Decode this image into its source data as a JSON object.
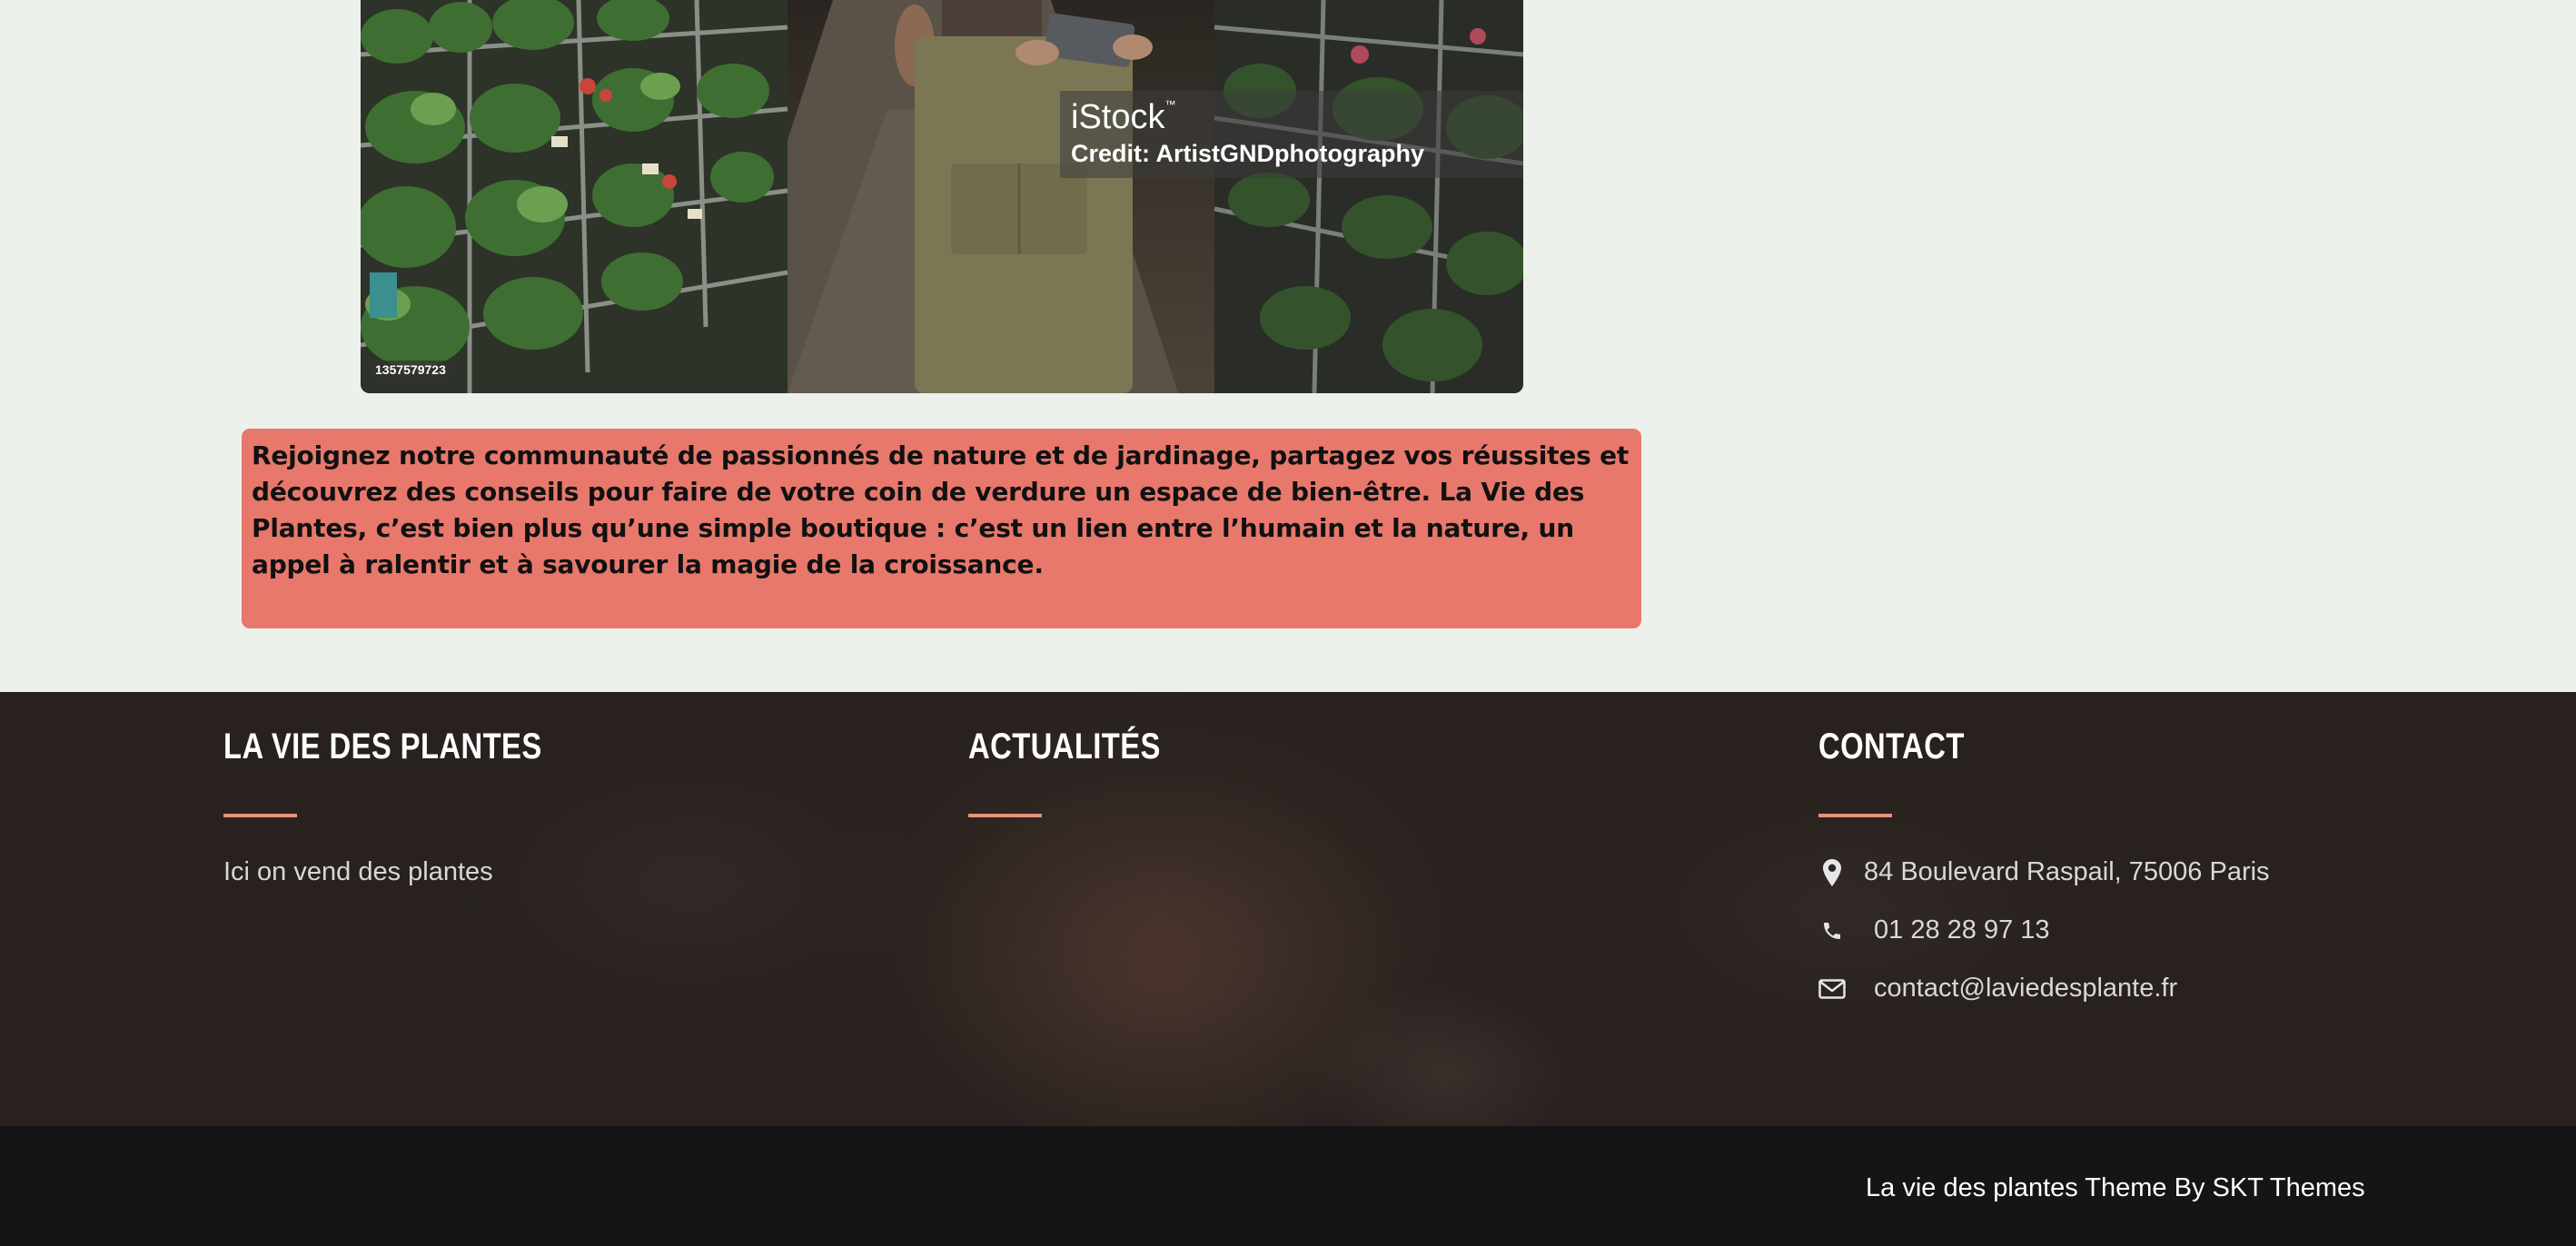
{
  "hero": {
    "watermark_logo": "iStock",
    "watermark_trademark": "™",
    "credit": "Credit: ArtistGNDphotography",
    "image_id": "1357579723"
  },
  "callout": {
    "text": "Rejoignez notre communauté de passionnés de nature et de jardinage, partagez vos réussites et découvrez des conseils pour faire de votre coin de verdure un espace de bien-être. La Vie des Plantes, c’est bien plus qu’une simple boutique : c’est un lien entre l’humain et la nature, un appel à ralentir et à savourer la magie de la croissance.",
    "background_color": "#e8786c"
  },
  "footer": {
    "columns": [
      {
        "heading": "LA VIE DES PLANTES",
        "text": "Ici on vend des plantes"
      },
      {
        "heading": "ACTUALITÉS"
      },
      {
        "heading": "CONTACT"
      }
    ],
    "contact": {
      "address": "84 Boulevard Raspail, 75006 Paris",
      "phone": "01 28 28 97 13",
      "email": "contact@laviedesplante.fr",
      "icons": [
        "map-marker-icon",
        "phone-icon",
        "envelope-icon"
      ]
    },
    "accent_color": "#e8917d"
  },
  "bottom_bar": {
    "copyright": "La vie des plantes Theme By SKT Themes"
  }
}
